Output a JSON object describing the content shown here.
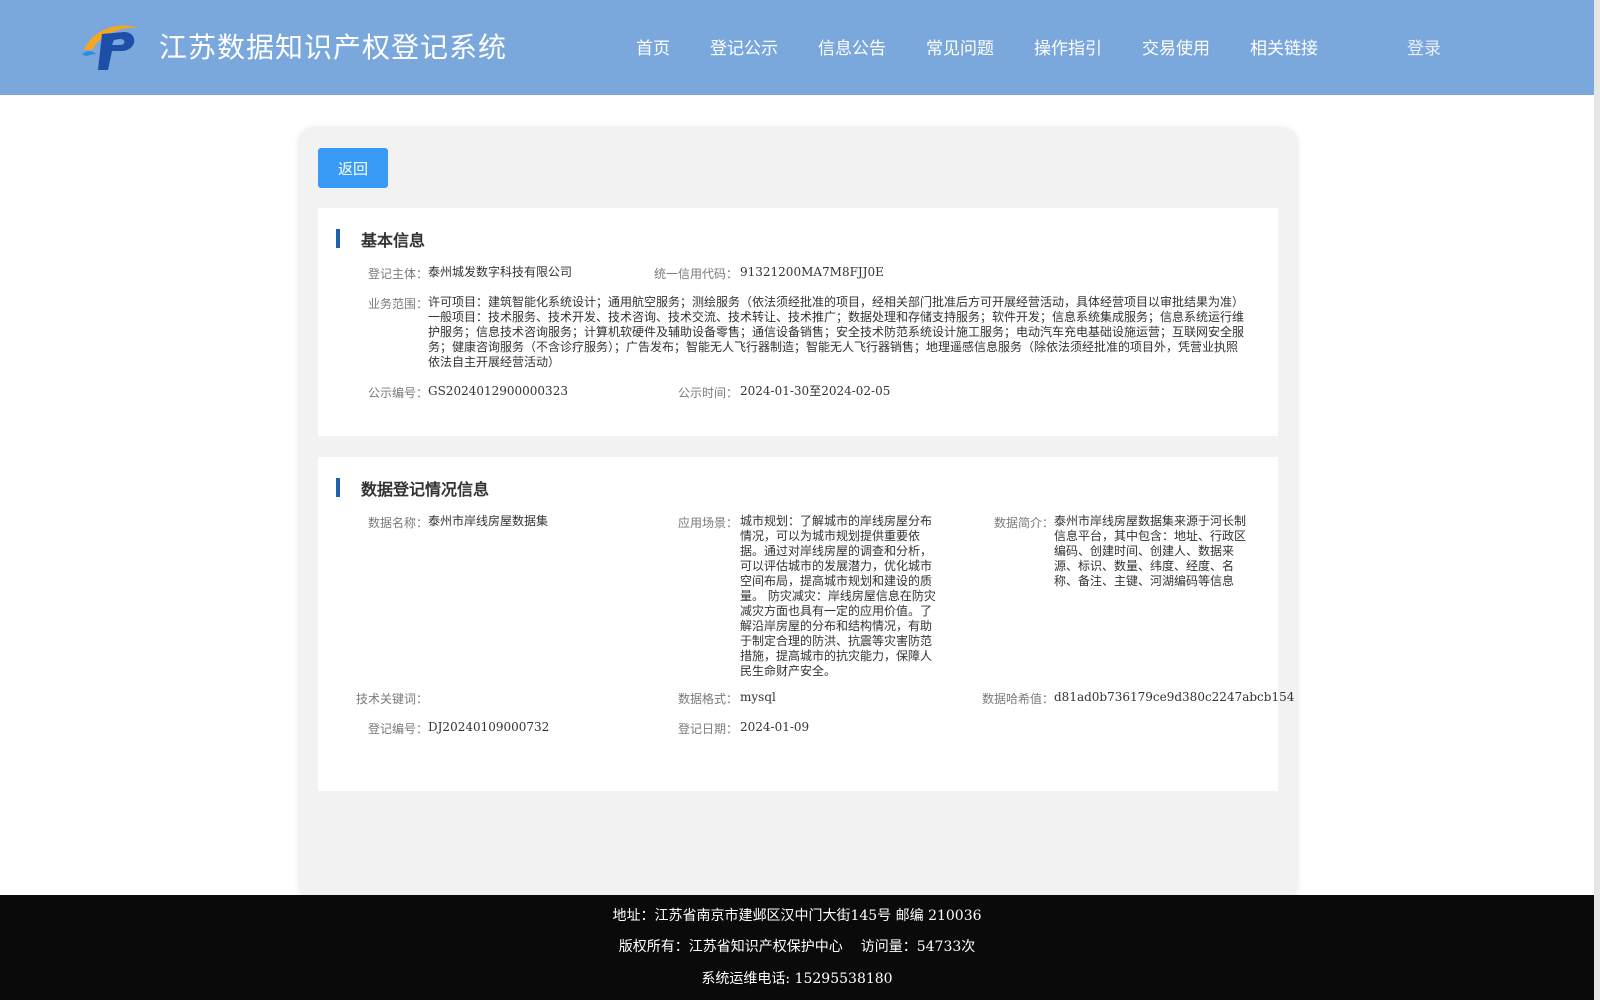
{
  "header": {
    "title": "江苏数据知识产权登记系统",
    "nav": [
      "首页",
      "登记公示",
      "信息公告",
      "常见问题",
      "操作指引",
      "交易使用",
      "相关链接"
    ],
    "login": "登录",
    "logo_icon": "ip-logo-icon"
  },
  "back_label": "返回",
  "basic": {
    "title": "基本信息",
    "subject_label": "登记主体：",
    "subject": "泰州城发数字科技有限公司",
    "credit_label": "统一信用代码：",
    "credit": "91321200MA7M8FJJ0E",
    "scope_label": "业务范围：",
    "scope": "许可项目：建筑智能化系统设计；通用航空服务；测绘服务（依法须经批准的项目，经相关部门批准后方可开展经营活动，具体经营项目以审批结果为准）一般项目：技术服务、技术开发、技术咨询、技术交流、技术转让、技术推广；数据处理和存储支持服务；软件开发；信息系统集成服务；信息系统运行维护服务；信息技术咨询服务；计算机软硬件及辅助设备零售；通信设备销售；安全技术防范系统设计施工服务；电动汽车充电基础设施运营；互联网安全服务；健康咨询服务（不含诊疗服务）；广告发布；智能无人飞行器制造；智能无人飞行器销售；地理遥感信息服务（除依法须经批准的项目外，凭营业执照依法自主开展经营活动）",
    "notice_no_label": "公示编号：",
    "notice_no": "GS2024012900000323",
    "notice_time_label": "公示时间：",
    "notice_time": "2024-01-30至2024-02-05"
  },
  "registration": {
    "title": "数据登记情况信息",
    "name_label": "数据名称：",
    "name": "泰州市岸线房屋数据集",
    "scenario_label": "应用场景：",
    "scenario": "城市规划：了解城市的岸线房屋分布情况，可以为城市规划提供重要依据。通过对岸线房屋的调查和分析，可以评估城市的发展潜力，优化城市空间布局，提高城市规划和建设的质量。 防灾减灾：岸线房屋信息在防灾减灾方面也具有一定的应用价值。了解沿岸房屋的分布和结构情况，有助于制定合理的防洪、抗震等灾害防范措施，提高城市的抗灾能力，保障人民生命财产安全。",
    "intro_label": "数据简介：",
    "intro": "泰州市岸线房屋数据集来源于河长制信息平台，其中包含：地址、行政区编码、创建时间、创建人、数据来源、标识、数量、纬度、经度、名称、备注、主键、河湖编码等信息",
    "keywords_label": "技术关键词：",
    "keywords": "",
    "format_label": "数据格式：",
    "format": "mysql",
    "hash_label": "数据哈希值：",
    "hash": "d81ad0b736179ce9d380c2247abcb154",
    "reg_no_label": "登记编号：",
    "reg_no": "DJ20240109000732",
    "reg_date_label": "登记日期：",
    "reg_date": "2024-01-09"
  },
  "footer": {
    "address": "地址：江苏省南京市建邺区汉中门大街145号 邮编 210036",
    "copyright": "版权所有：江苏省知识产权保护中心",
    "visits": "访问量：54733次",
    "phone": "系统运维电话: 15295538180"
  },
  "colors": {
    "header_bg": "#7aa8dc",
    "button_bg": "#3a9bf7",
    "section_bar": "#1f5fb0",
    "footer_bg": "#0a0a0a"
  }
}
